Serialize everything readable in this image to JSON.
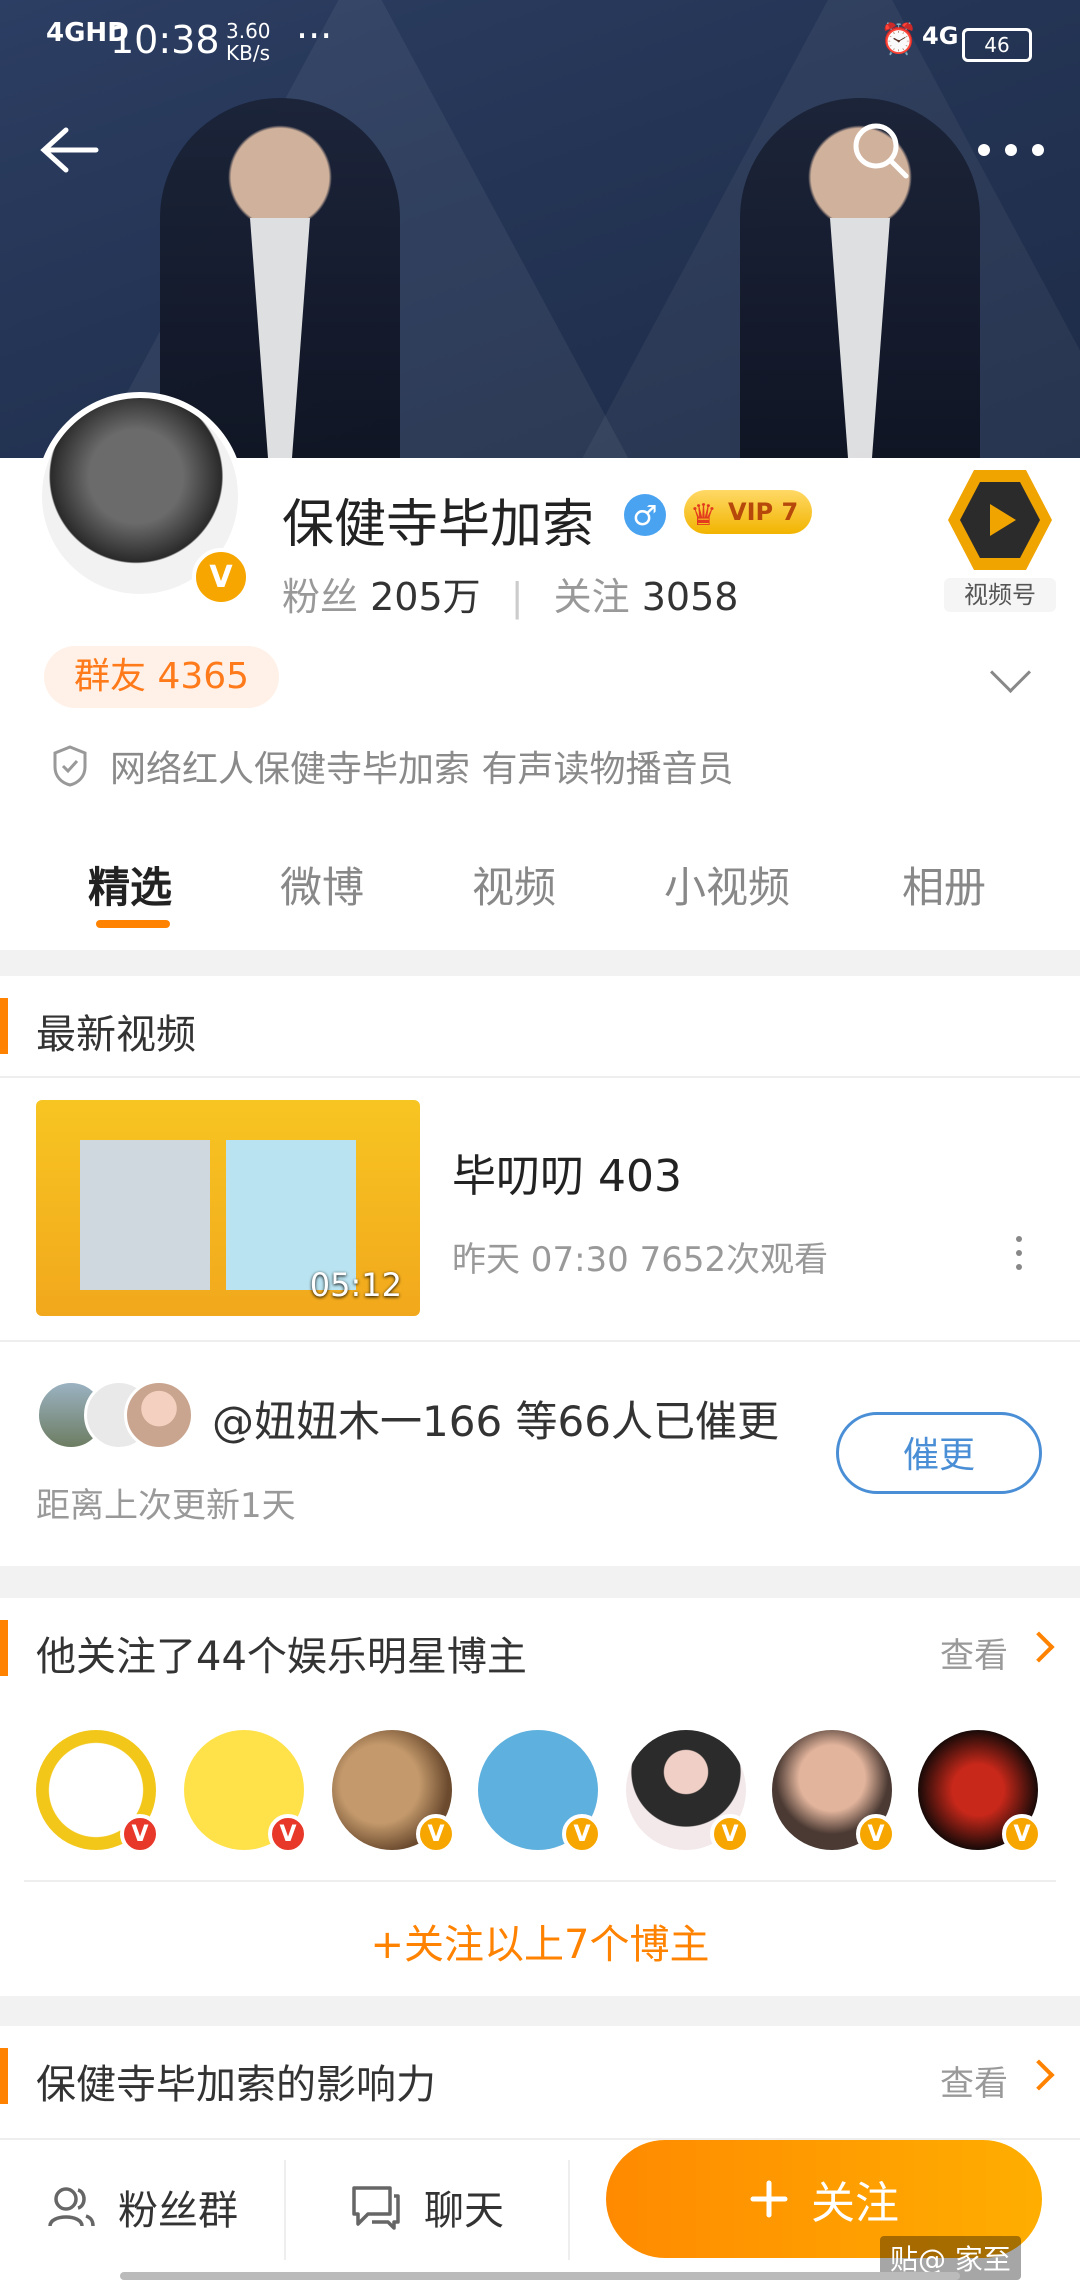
{
  "status_bar": {
    "network": "4GHD",
    "time": "10:38",
    "speed_value": "3.60",
    "speed_unit": "KB/s",
    "dots": "···",
    "net_right": "4G",
    "battery": "46"
  },
  "profile": {
    "name": "保健寺毕加索",
    "vip_label": "VIP 7",
    "fans_label": "粉丝",
    "fans_count": "205万",
    "following_label": "关注",
    "following_count": "3058",
    "video_badge_label": "视频号",
    "group_pill": "群友 4365",
    "certification": "网络红人保健寺毕加索 有声读物播音员"
  },
  "tabs": [
    "精选",
    "微博",
    "视频",
    "小视频",
    "相册"
  ],
  "latest_video": {
    "section_title": "最新视频",
    "title": "毕叨叨 403",
    "duration": "05:12",
    "meta": "昨天 07:30 7652次观看"
  },
  "urge": {
    "text": "@妞妞木一166 等66人已催更",
    "sub": "距离上次更新1天",
    "button": "催更"
  },
  "following_section": {
    "title": "他关注了44个娱乐明星博主",
    "more": "查看",
    "follow_all": "+关注以上7个博主"
  },
  "influence_section": {
    "title": "保健寺毕加索的影响力",
    "more": "查看"
  },
  "bottom_bar": {
    "fans_group": "粉丝群",
    "chat": "聊天",
    "follow": "关注",
    "watermark": "贴@ 家至"
  },
  "colors": {
    "accent": "#ff8200",
    "verified": "#f7a600",
    "link_blue": "#4a8fd6"
  }
}
